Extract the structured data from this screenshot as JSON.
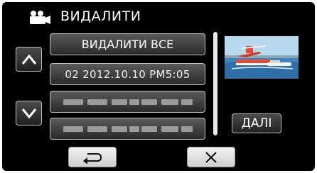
{
  "header": {
    "title": "ВИДАЛИТИ",
    "icon": "camcorder-icon"
  },
  "list": {
    "delete_all_label": "ВИДАЛИТИ ВСЕ",
    "items": [
      {
        "label": "02 2012.10.10 PM5:05"
      }
    ]
  },
  "buttons": {
    "next_label": "ДАЛІ",
    "up_icon": "chevron-up-icon",
    "down_icon": "chevron-down-icon",
    "back_icon": "return-arrow-icon",
    "close_icon": "close-icon"
  },
  "colors": {
    "background": "#000000",
    "button_light": "#e0e0e0",
    "text": "#ffffff"
  }
}
